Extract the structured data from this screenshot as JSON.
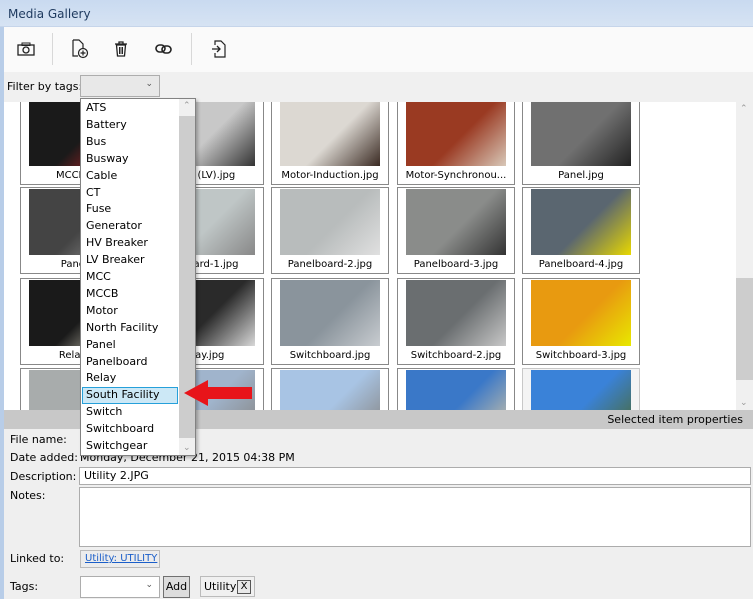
{
  "window": {
    "title": "Media Gallery"
  },
  "toolbar": {
    "buttons": [
      {
        "name": "camera-button",
        "icon": "camera-icon",
        "tooltip": ""
      },
      {
        "name": "add-file-button",
        "icon": "add-file-icon"
      },
      {
        "name": "delete-button",
        "icon": "trash-icon"
      },
      {
        "name": "link-button",
        "icon": "link-icon"
      },
      {
        "name": "import-button",
        "icon": "import-icon"
      }
    ]
  },
  "filter": {
    "label": "Filter by tags:",
    "value": ""
  },
  "tag_dropdown": {
    "options": [
      "ATS",
      "Battery",
      "Bus",
      "Busway",
      "Cable",
      "CT",
      "Fuse",
      "Generator",
      "HV Breaker",
      "LV Breaker",
      "MCC",
      "MCCB",
      "Motor",
      "North Facility",
      "Panel",
      "Panelboard",
      "Relay",
      "South Facility",
      "Switch",
      "Switchboard",
      "Switchgear"
    ],
    "highlighted": "South Facility"
  },
  "gallery": {
    "items": [
      {
        "caption": "MCCB (...",
        "colors": [
          "#1a1a1a",
          "#d8262a"
        ]
      },
      {
        "caption": "...-2 (LV).jpg",
        "colors": [
          "#c8c8c8",
          "#333"
        ]
      },
      {
        "caption": "Motor-Induction.jpg",
        "colors": [
          "#dcd8d2",
          "#3a2a22"
        ]
      },
      {
        "caption": "Motor-Synchronou...",
        "colors": [
          "#9a3a22",
          "#d8c8b8"
        ]
      },
      {
        "caption": "Panel.jpg",
        "colors": [
          "#707070",
          "#222"
        ]
      },
      {
        "caption": "Panel...",
        "colors": [
          "#444",
          "#999"
        ]
      },
      {
        "caption": "...board-1.jpg",
        "colors": [
          "#bfc6c6",
          "#888"
        ]
      },
      {
        "caption": "Panelboard-2.jpg",
        "colors": [
          "#b8bcbc",
          "#e0e0e0"
        ]
      },
      {
        "caption": "Panelboard-3.jpg",
        "colors": [
          "#8a8c8a",
          "#333"
        ]
      },
      {
        "caption": "Panelboard-4.jpg",
        "colors": [
          "#5a6670",
          "#e8d800"
        ]
      },
      {
        "caption": "Relay ...",
        "colors": [
          "#1a1a1a",
          "#e8e4d0"
        ]
      },
      {
        "caption": "...ay.jpg",
        "colors": [
          "#2a2a2a",
          "#d8d8d8"
        ]
      },
      {
        "caption": "Switchboard.jpg",
        "colors": [
          "#8a949c",
          "#c8ccd0"
        ]
      },
      {
        "caption": "Switchboard-2.jpg",
        "colors": [
          "#6a6e70",
          "#c8c8c8"
        ]
      },
      {
        "caption": "Switchboard-3.jpg",
        "colors": [
          "#e89a10",
          "#e8e800"
        ]
      },
      {
        "caption": "",
        "colors": [
          "#a8acac",
          "#c8c8c8"
        ]
      },
      {
        "caption": "",
        "colors": [
          "#a0b4cc",
          "#888"
        ]
      },
      {
        "caption": "",
        "colors": [
          "#a8c4e4",
          "#888"
        ]
      },
      {
        "caption": "",
        "colors": [
          "#3a78c8",
          "#c8c0a8"
        ]
      },
      {
        "caption": "",
        "colors": [
          "#3a82d8",
          "#4a6a3a"
        ]
      }
    ],
    "selected_index": 19,
    "scroll_position_fraction": 0.65
  },
  "properties": {
    "header": "Selected item properties",
    "file_name_label": "File name:",
    "file_name_value": "",
    "date_added_label": "Date added:",
    "date_added_value": "Monday, December 21, 2015 04:38 PM",
    "description_label": "Description:",
    "description_value": "Utility 2.JPG",
    "notes_label": "Notes:",
    "notes_value": "",
    "linked_to_label": "Linked to:",
    "linked_to_value": "Utility: UTILITY",
    "tags_label": "Tags:",
    "tags_input_value": "",
    "add_button": "Add",
    "tags": [
      {
        "label": "Utility",
        "remove": "X"
      }
    ]
  },
  "annotation": {
    "arrow_color": "#e8141a",
    "points_to": "South Facility"
  }
}
